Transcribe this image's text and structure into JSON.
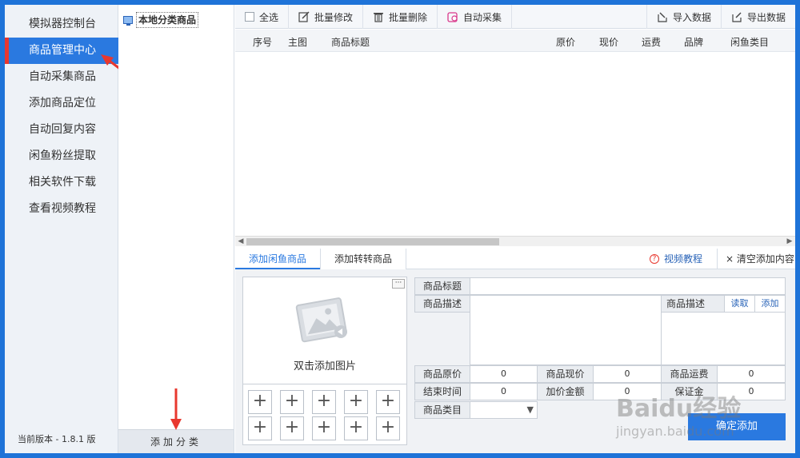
{
  "sidebar": {
    "items": [
      {
        "label": "模拟器控制台"
      },
      {
        "label": "商品管理中心"
      },
      {
        "label": "自动采集商品"
      },
      {
        "label": "添加商品定位"
      },
      {
        "label": "自动回复内容"
      },
      {
        "label": "闲鱼粉丝提取"
      },
      {
        "label": "相关软件下载"
      },
      {
        "label": "查看视频教程"
      }
    ],
    "active_index": 1,
    "version": "当前版本 - 1.8.1 版"
  },
  "tree": {
    "root_label": "本地分类商品",
    "add_category_label": "添加分类"
  },
  "toolbar": {
    "select_all": "全选",
    "batch_edit": "批量修改",
    "batch_delete": "批量删除",
    "auto_collect": "自动采集",
    "import_data": "导入数据",
    "export_data": "导出数据"
  },
  "grid": {
    "columns": [
      "序号",
      "主图",
      "商品标题",
      "原价",
      "现价",
      "运费",
      "品牌",
      "闲鱼类目"
    ]
  },
  "tabs": {
    "tab1": "添加闲鱼商品",
    "tab2": "添加转转商品",
    "tutorial": "视频教程",
    "clear": "清空添加内容"
  },
  "image_panel": {
    "caption": "双击添加图片",
    "more": "···"
  },
  "form": {
    "title_label": "商品标题",
    "title_value": "",
    "desc_label": "商品描述",
    "desc_label2": "商品描述",
    "read_link": "读取",
    "add_link": "添加",
    "orig_price_label": "商品原价",
    "orig_price_value": "0",
    "cur_price_label": "商品现价",
    "cur_price_value": "0",
    "shipping_label": "商品运费",
    "shipping_value": "0",
    "end_time_label": "结束时间",
    "end_time_value": "0",
    "markup_label": "加价金额",
    "markup_value": "0",
    "deposit_label": "保证金",
    "deposit_value": "0",
    "category_label": "商品类目",
    "category_value": ""
  },
  "confirm_button": "确定添加",
  "watermark": {
    "main": "Baidu经验",
    "sub": "jingyan.baidu.com"
  },
  "colors": {
    "accent": "#2a79e0",
    "active_marker": "#e8382f",
    "frame": "#1e73d8"
  }
}
